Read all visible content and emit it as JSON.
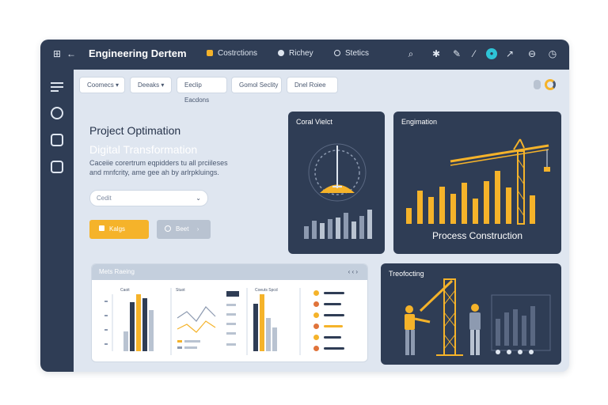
{
  "window": {
    "title": "Engineering Dertem",
    "nav": [
      {
        "label": "Costrctions",
        "color": "#f5b32a"
      },
      {
        "label": "Richey",
        "color": "#dfe6f0"
      },
      {
        "label": "Stetics",
        "color": "#dfe6f0"
      }
    ],
    "icons": [
      "grid-icon",
      "back-arrow-icon",
      "search-icon",
      "bug-icon",
      "pencil-icon",
      "slash-icon",
      "teal-status-icon",
      "share-icon",
      "minus-circle-icon",
      "clock-icon"
    ]
  },
  "sidebar": {
    "items": [
      "list-icon",
      "gauge-icon",
      "inbox-icon",
      "edit-icon"
    ]
  },
  "filters": [
    "Coomecs",
    "Deeaks",
    "Eeclip Eacdons",
    "Gomol Seclity",
    "Dnel Roiee"
  ],
  "hero": {
    "title": "Project Optimation",
    "subtitle": "Digital Transformation",
    "description": "Caceiie corertrum eqpidders tu all prciileses and mnfcrity, ame gee ah by arlrpkluings.",
    "select_placeholder": "Cedit",
    "primary_label": "Kalgs",
    "secondary_label": "Beet"
  },
  "cards": {
    "card1_title": "Coral Vielct",
    "card2_title": "Engimation",
    "card2_caption": "Process Construction",
    "card3_title": "Mets Raeing",
    "card3_pager": "‹ ‹ ›",
    "card3_col1": "Caoit",
    "card3_col2": "Stuot",
    "card3_col3": "Coeuts Spcd",
    "card4_title": "Treofocting"
  },
  "colors": {
    "dark": "#2f3d55",
    "accent": "#f5b32a",
    "panel": "#dfe6f0",
    "muted": "#8d9ab0"
  }
}
